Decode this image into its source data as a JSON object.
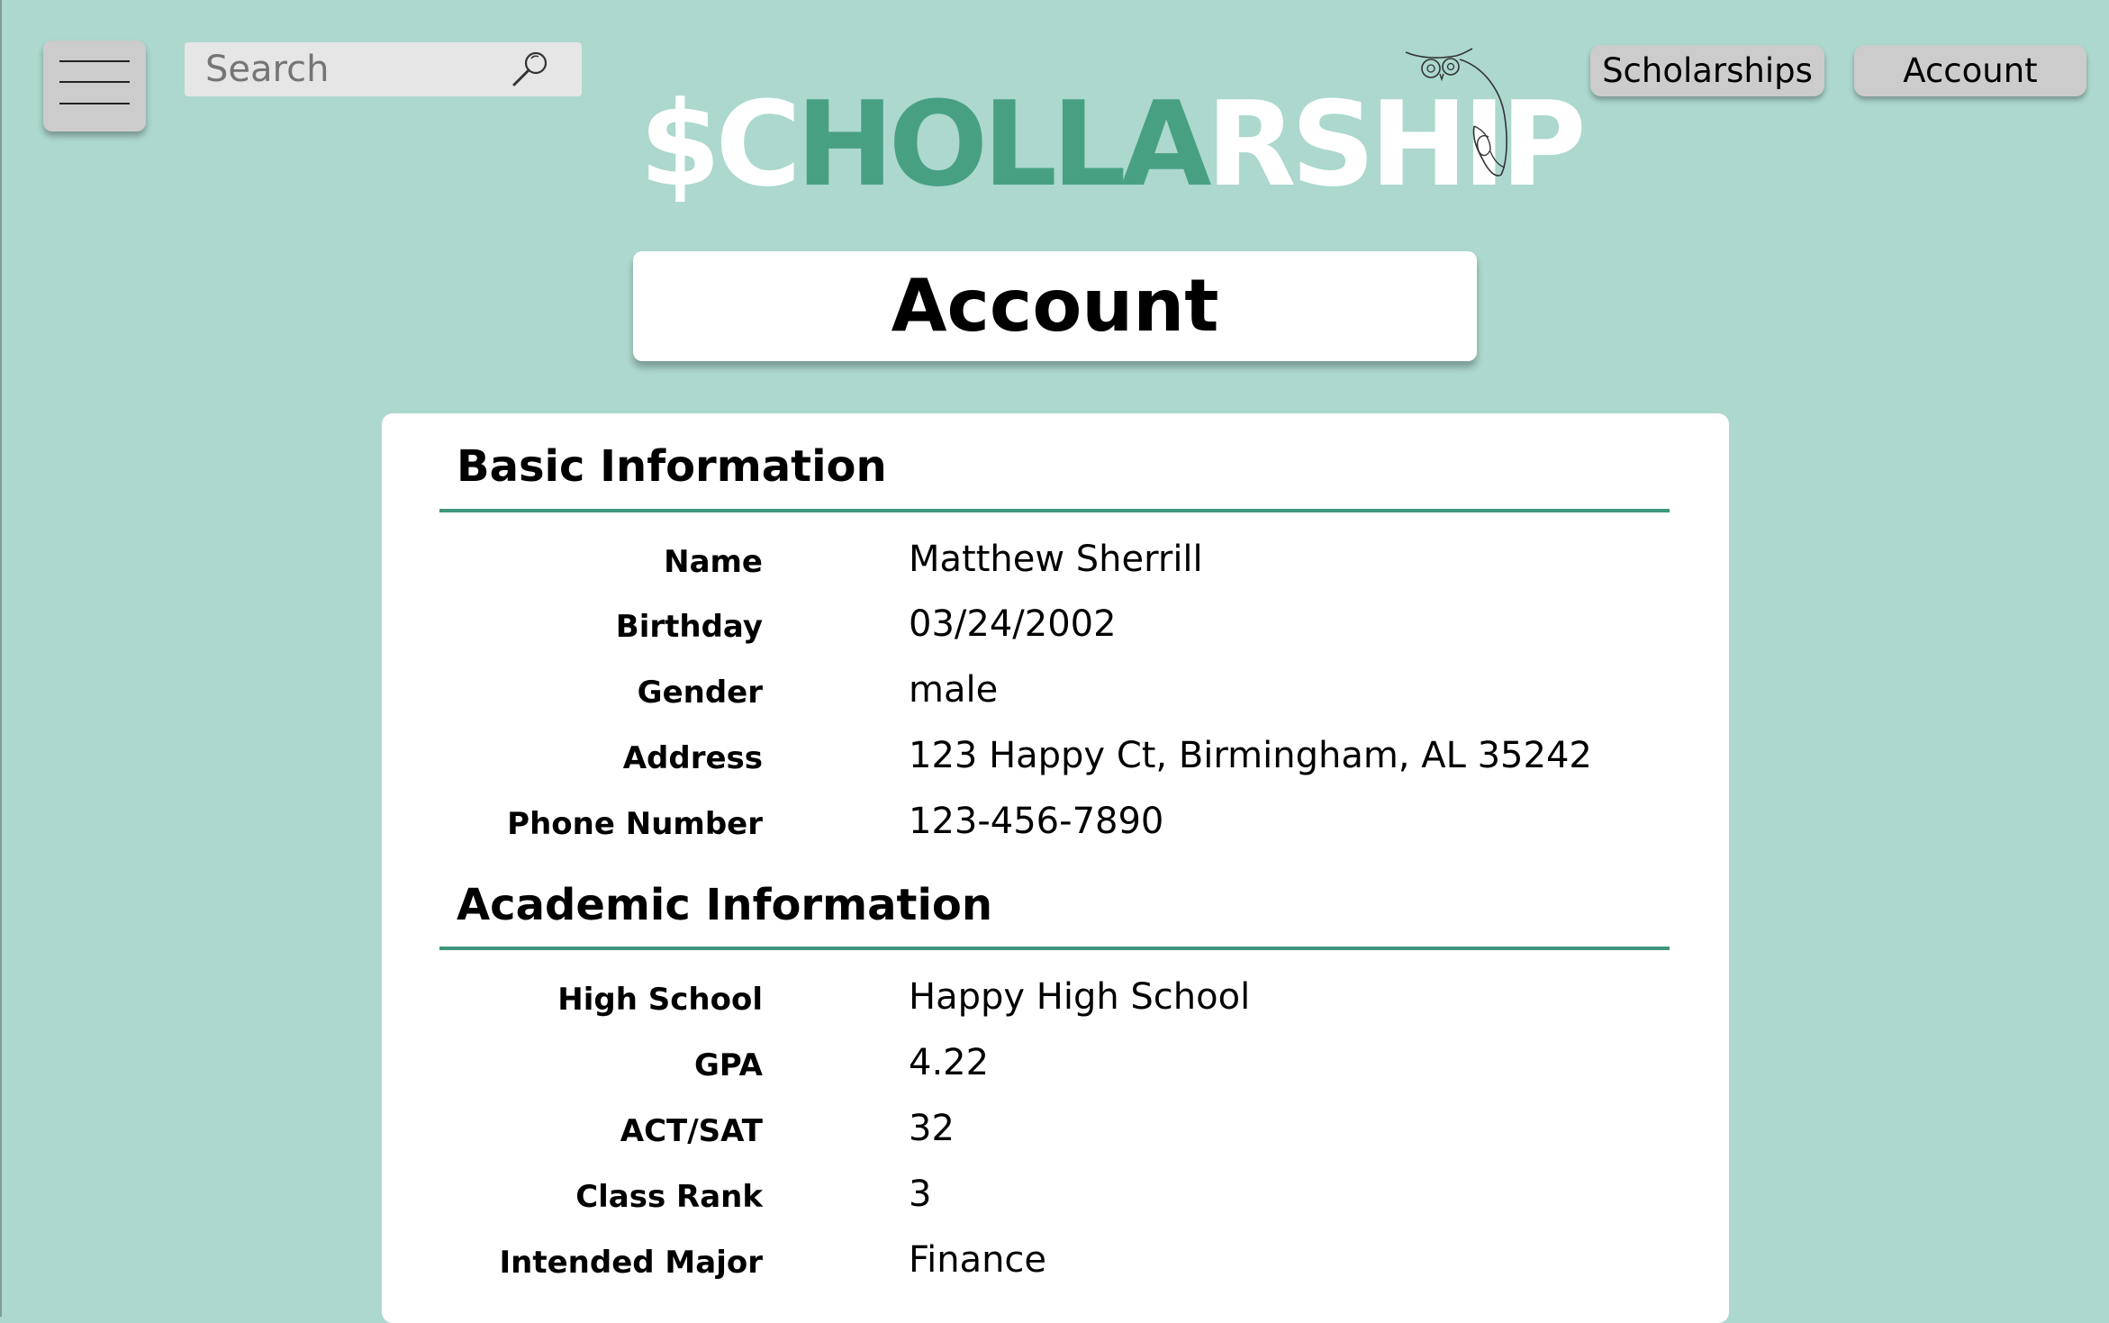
{
  "header": {
    "search": {
      "placeholder": "Search"
    },
    "nav": [
      {
        "label": "Scholarships"
      },
      {
        "label": "Account"
      }
    ],
    "logo": {
      "text_parts": [
        "$C",
        "HOLLA",
        "RSHIP"
      ],
      "colors": {
        "white": "#ffffff",
        "green": "#48a083"
      }
    }
  },
  "page": {
    "title": "Account"
  },
  "basic_info": {
    "title": "Basic Information",
    "rows": [
      {
        "label": "Name",
        "value": "Matthew Sherrill"
      },
      {
        "label": "Birthday",
        "value": "03/24/2002"
      },
      {
        "label": "Gender",
        "value": "male"
      },
      {
        "label": "Address",
        "value": "123 Happy Ct, Birmingham, AL 35242"
      },
      {
        "label": "Phone Number",
        "value": "123-456-7890"
      }
    ]
  },
  "academic_info": {
    "title": "Academic Information",
    "rows": [
      {
        "label": "High School",
        "value": "Happy High School"
      },
      {
        "label": "GPA",
        "value": "4.22"
      },
      {
        "label": "ACT/SAT",
        "value": "32"
      },
      {
        "label": "Class Rank",
        "value": "3"
      },
      {
        "label": "Intended Major",
        "value": "Finance"
      }
    ]
  },
  "theme": {
    "background": "#acd8ce",
    "accent": "#3f967d",
    "button_gray": "#cccccc"
  },
  "icons": {
    "menu": "hamburger-menu-icon",
    "search": "magnifier-icon",
    "logo_mascot": "owl-icon"
  }
}
